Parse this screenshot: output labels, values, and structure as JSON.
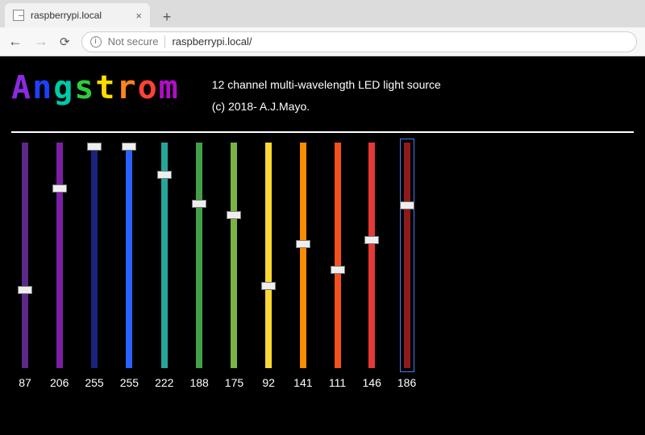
{
  "browser": {
    "tab_title": "raspberrypi.local",
    "security_label": "Not secure",
    "url": "raspberrypi.local/"
  },
  "header": {
    "logo_letters": [
      {
        "ch": "A",
        "color": "#8a2be2"
      },
      {
        "ch": "n",
        "color": "#1e40ff"
      },
      {
        "ch": "g",
        "color": "#00c9a7"
      },
      {
        "ch": "s",
        "color": "#2ecc40"
      },
      {
        "ch": "t",
        "color": "#ffdc00"
      },
      {
        "ch": "r",
        "color": "#ff851b"
      },
      {
        "ch": "o",
        "color": "#ff4136"
      },
      {
        "ch": "m",
        "color": "#b10dc9"
      }
    ],
    "tagline": "12 channel multi-wavelength LED light source",
    "copyright": "(c) 2018- A.J.Mayo."
  },
  "sliders": {
    "max": 255,
    "channels": [
      {
        "value": 87,
        "color": "#5b2a86"
      },
      {
        "value": 206,
        "color": "#7b1fa2"
      },
      {
        "value": 255,
        "color": "#1a237e"
      },
      {
        "value": 255,
        "color": "#2962ff"
      },
      {
        "value": 222,
        "color": "#26a69a"
      },
      {
        "value": 188,
        "color": "#43a047"
      },
      {
        "value": 175,
        "color": "#7cb342"
      },
      {
        "value": 92,
        "color": "#fdd835"
      },
      {
        "value": 141,
        "color": "#fb8c00"
      },
      {
        "value": 111,
        "color": "#f4511e"
      },
      {
        "value": 146,
        "color": "#e53935"
      },
      {
        "value": 186,
        "color": "#8e1b1b",
        "selected": true
      }
    ]
  }
}
